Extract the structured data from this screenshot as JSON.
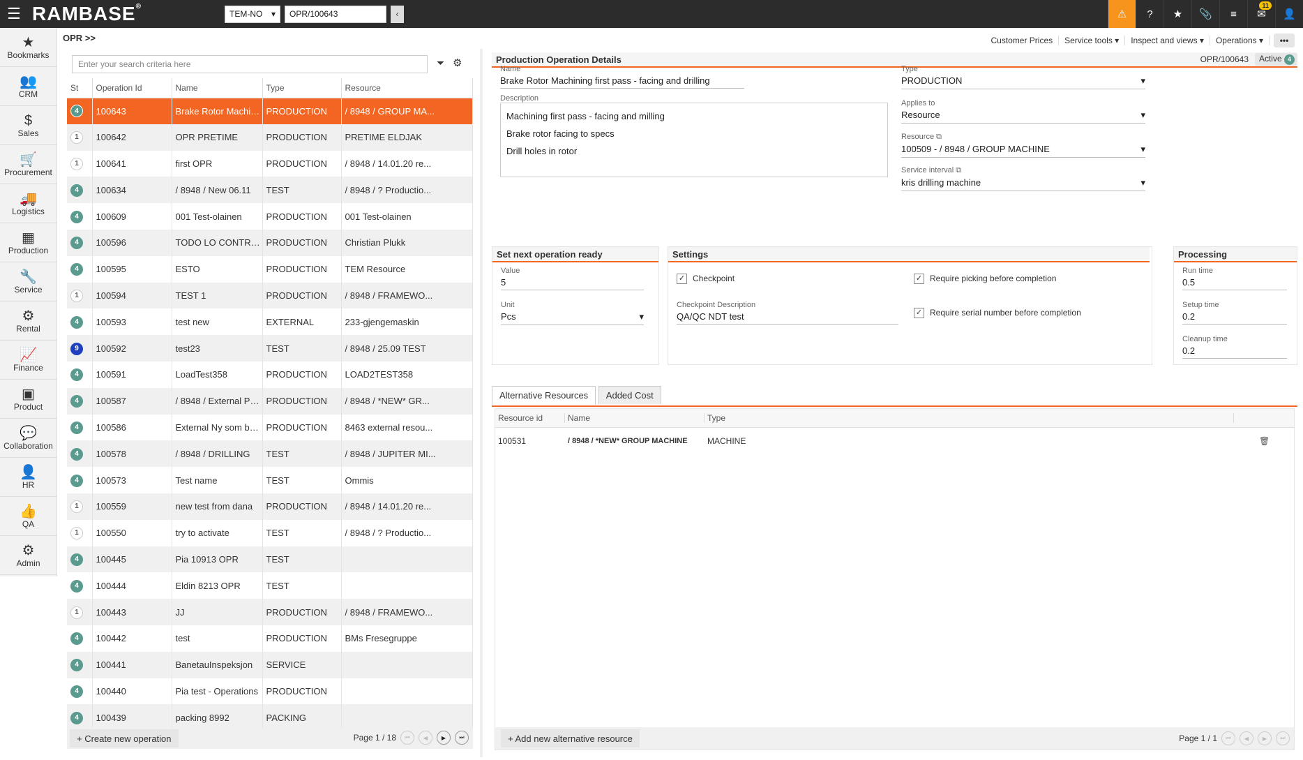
{
  "app": {
    "logo": "RAMBASE",
    "logo_mark": "®",
    "company": "TEM-NO",
    "document": "OPR/100643",
    "notification_count": "11"
  },
  "nav": {
    "items": [
      {
        "label": "Bookmarks",
        "icon": "star-icon",
        "glyph": "★"
      },
      {
        "label": "CRM",
        "icon": "users-icon",
        "glyph": "👥"
      },
      {
        "label": "Sales",
        "icon": "money-icon",
        "glyph": "$"
      },
      {
        "label": "Procurement",
        "icon": "cart-icon",
        "glyph": "🛒"
      },
      {
        "label": "Logistics",
        "icon": "truck-icon",
        "glyph": "🚚"
      },
      {
        "label": "Production",
        "icon": "boxes-icon",
        "glyph": "▦"
      },
      {
        "label": "Service",
        "icon": "wrench-icon",
        "glyph": "🔧"
      },
      {
        "label": "Rental",
        "icon": "rental-icon",
        "glyph": "⚙"
      },
      {
        "label": "Finance",
        "icon": "chart-icon",
        "glyph": "📈"
      },
      {
        "label": "Product",
        "icon": "cube-icon",
        "glyph": "▣"
      },
      {
        "label": "Collaboration",
        "icon": "chat-icon",
        "glyph": "💬"
      },
      {
        "label": "HR",
        "icon": "person-icon",
        "glyph": "👤"
      },
      {
        "label": "QA",
        "icon": "thumbs-up-icon",
        "glyph": "👍"
      },
      {
        "label": "Admin",
        "icon": "gear-icon",
        "glyph": "⚙"
      }
    ]
  },
  "breadcrumb": "OPR >>",
  "topmenu": {
    "customer_prices": "Customer Prices",
    "service_tools": "Service tools ▾",
    "inspect_views": "Inspect and views ▾",
    "operations": "Operations ▾",
    "more": "•••"
  },
  "list": {
    "search_placeholder": "Enter your search criteria here",
    "columns": [
      "St",
      "Operation Id",
      "Name",
      "Type",
      "Resource"
    ],
    "rows": [
      {
        "st": "4",
        "id": "100643",
        "name": "Brake Rotor Machin...",
        "type": "PRODUCTION",
        "resource": "/ 8948 / GROUP MA..."
      },
      {
        "st": "1",
        "id": "100642",
        "name": "OPR PRETIME",
        "type": "PRODUCTION",
        "resource": "PRETIME ELDJAK"
      },
      {
        "st": "1",
        "id": "100641",
        "name": "first OPR",
        "type": "PRODUCTION",
        "resource": "/ 8948 / 14.01.20 re..."
      },
      {
        "st": "4",
        "id": "100634",
        "name": "/ 8948 / New 06.11",
        "type": "TEST",
        "resource": "/ 8948 / ? Productio..."
      },
      {
        "st": "4",
        "id": "100609",
        "name": "001 Test-olainen",
        "type": "PRODUCTION",
        "resource": "001 Test-olainen"
      },
      {
        "st": "4",
        "id": "100596",
        "name": "TODO LO CONTRA...",
        "type": "PRODUCTION",
        "resource": "Christian Plukk"
      },
      {
        "st": "4",
        "id": "100595",
        "name": "ESTO",
        "type": "PRODUCTION",
        "resource": "TEM Resource"
      },
      {
        "st": "1",
        "id": "100594",
        "name": "TEST 1",
        "type": "PRODUCTION",
        "resource": "/ 8948 / FRAMEWO..."
      },
      {
        "st": "4",
        "id": "100593",
        "name": "test new",
        "type": "EXTERNAL",
        "resource": "233-gjengemaskin"
      },
      {
        "st": "9",
        "id": "100592",
        "name": "test23",
        "type": "TEST",
        "resource": "/ 8948 / 25.09 TEST"
      },
      {
        "st": "4",
        "id": "100591",
        "name": "LoadTest358",
        "type": "PRODUCTION",
        "resource": "LOAD2TEST358"
      },
      {
        "st": "4",
        "id": "100587",
        "name": "/ 8948 / External Pa...",
        "type": "PRODUCTION",
        "resource": "/ 8948 / *NEW* GR..."
      },
      {
        "st": "4",
        "id": "100586",
        "name": "External Ny som ba...",
        "type": "PRODUCTION",
        "resource": "8463 external resou..."
      },
      {
        "st": "4",
        "id": "100578",
        "name": "/ 8948 / DRILLING",
        "type": "TEST",
        "resource": "/ 8948 / JUPITER MI..."
      },
      {
        "st": "4",
        "id": "100573",
        "name": "Test name",
        "type": "TEST",
        "resource": "Ommis"
      },
      {
        "st": "1",
        "id": "100559",
        "name": "new test from dana",
        "type": "PRODUCTION",
        "resource": "/ 8948 / 14.01.20 re..."
      },
      {
        "st": "1",
        "id": "100550",
        "name": "try to activate",
        "type": "TEST",
        "resource": "/ 8948 / ? Productio..."
      },
      {
        "st": "4",
        "id": "100445",
        "name": "Pia 10913 OPR",
        "type": "TEST",
        "resource": ""
      },
      {
        "st": "4",
        "id": "100444",
        "name": "Eldin 8213 OPR",
        "type": "TEST",
        "resource": ""
      },
      {
        "st": "1",
        "id": "100443",
        "name": "JJ",
        "type": "PRODUCTION",
        "resource": "/ 8948 / FRAMEWO..."
      },
      {
        "st": "4",
        "id": "100442",
        "name": "test",
        "type": "PRODUCTION",
        "resource": "BMs Fresegruppe"
      },
      {
        "st": "4",
        "id": "100441",
        "name": "BanetauInspeksjon",
        "type": "SERVICE",
        "resource": ""
      },
      {
        "st": "4",
        "id": "100440",
        "name": "Pia test - Operations",
        "type": "PRODUCTION",
        "resource": ""
      },
      {
        "st": "4",
        "id": "100439",
        "name": "packing 8992",
        "type": "PACKING",
        "resource": ""
      }
    ],
    "create_label": "+ Create new operation",
    "page": "Page 1 / 18"
  },
  "detail": {
    "title": "Production Operation Details",
    "doc_id": "OPR/100643",
    "status": "Active",
    "status_num": "4",
    "name_label": "Name",
    "name": "Brake Rotor Machining first pass - facing and drilling",
    "desc_label": "Description",
    "desc_lines": [
      "Machining first pass - facing and milling",
      "Brake rotor facing to specs",
      "Drill holes in rotor"
    ],
    "type_label": "Type",
    "type": "PRODUCTION",
    "applies_label": "Applies to",
    "applies": "Resource",
    "resource_label": "Resource",
    "resource": "100509 - / 8948 / GROUP MACHINE",
    "interval_label": "Service interval",
    "interval": "kris drilling machine",
    "next_head": "Set next operation ready",
    "value_label": "Value",
    "value": "5",
    "unit_label": "Unit",
    "unit": "Pcs",
    "settings_head": "Settings",
    "checkpoint": "Checkpoint",
    "cp_desc_label": "Checkpoint Description",
    "cp_desc": "QA/QC NDT test",
    "req_pick": "Require picking before completion",
    "req_serial": "Require serial number before completion",
    "processing_head": "Processing",
    "run_label": "Run time",
    "run": "0.5",
    "setup_label": "Setup time",
    "setup": "0.2",
    "cleanup_label": "Cleanup time",
    "cleanup": "0.2",
    "tabs": [
      "Alternative Resources",
      "Added Cost"
    ],
    "alt_cols": [
      "Resource id",
      "Name",
      "Type"
    ],
    "alt_row": {
      "id": "100531",
      "name": "/ 8948 / *NEW* GROUP MACHINE",
      "type": "MACHINE"
    },
    "add_alt": "+ Add new alternative resource",
    "alt_page": "Page 1 / 1"
  }
}
